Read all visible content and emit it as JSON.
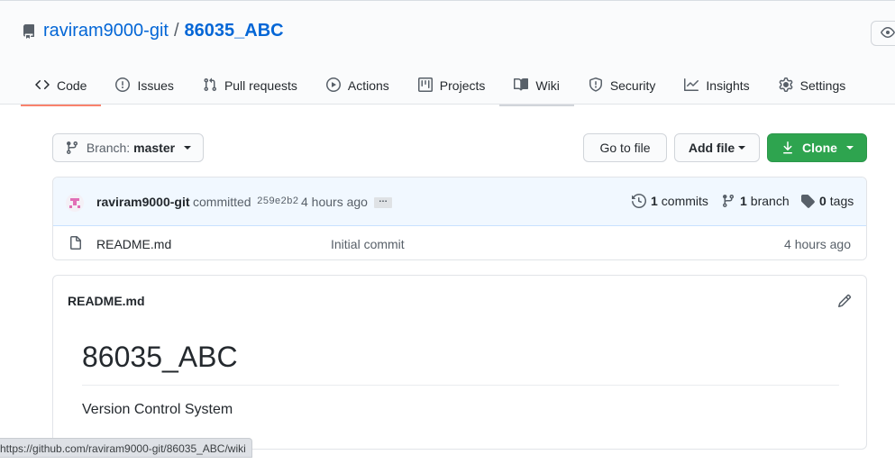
{
  "repo": {
    "owner": "raviram9000-git",
    "separator": "/",
    "name": "86035_ABC"
  },
  "tabs": [
    {
      "label": "Code",
      "icon": "code-icon",
      "selected": true
    },
    {
      "label": "Issues",
      "icon": "issue-opened-icon"
    },
    {
      "label": "Pull requests",
      "icon": "git-pull-request-icon"
    },
    {
      "label": "Actions",
      "icon": "play-icon"
    },
    {
      "label": "Projects",
      "icon": "project-icon"
    },
    {
      "label": "Wiki",
      "icon": "book-icon",
      "hovered": true
    },
    {
      "label": "Security",
      "icon": "shield-icon"
    },
    {
      "label": "Insights",
      "icon": "graph-icon"
    },
    {
      "label": "Settings",
      "icon": "gear-icon"
    }
  ],
  "toolbar": {
    "branch_prefix": "Branch:",
    "branch_name": "master",
    "goto_file": "Go to file",
    "add_file": "Add file",
    "clone": "Clone"
  },
  "commit": {
    "author": "raviram9000-git",
    "action": "committed",
    "sha": "259e2b2",
    "time": "4 hours ago",
    "ellipsis": "…",
    "commits_count": "1",
    "commits_label": "commits",
    "branch_count": "1",
    "branch_label": "branch",
    "tags_count": "0",
    "tags_label": "tags"
  },
  "files": [
    {
      "name": "README.md",
      "message": "Initial commit",
      "age": "4 hours ago"
    }
  ],
  "readme": {
    "filename": "README.md",
    "heading": "86035_ABC",
    "body": "Version Control System"
  },
  "status_bar": {
    "url": "https://github.com/raviram9000-git/86035_ABC/wiki"
  },
  "colors": {
    "link": "#0366d6",
    "clone_green": "#2ea44f",
    "selected_tab_underline": "#f9826c"
  }
}
